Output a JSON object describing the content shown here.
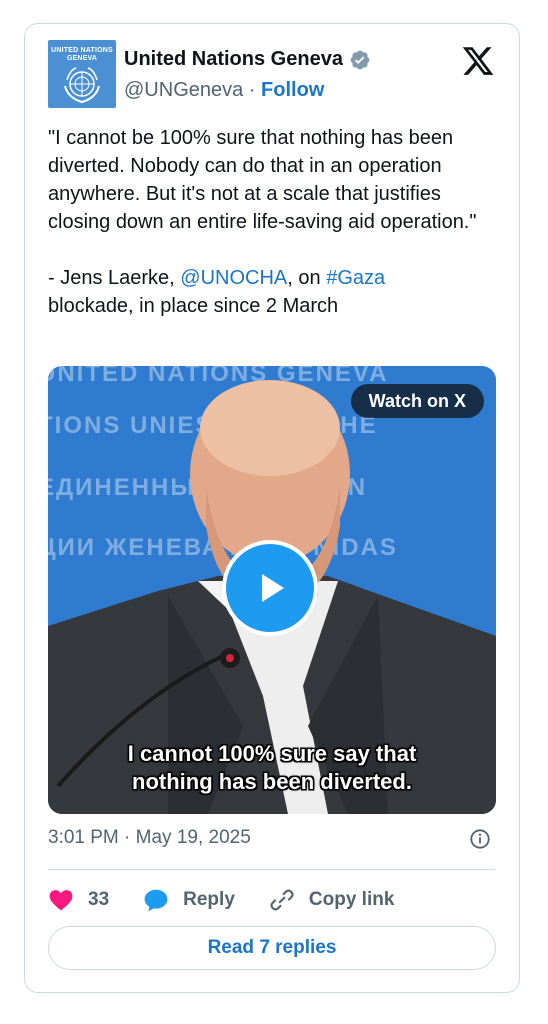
{
  "account": {
    "name": "United Nations Geneva",
    "handle": "@UNGeneva",
    "separator": "·",
    "follow_label": "Follow",
    "avatar_text_line1": "UNITED NATIONS",
    "avatar_text_line2": "GENEVA",
    "verified_color": "#829aab"
  },
  "tweet": {
    "quote": "\"I cannot be 100% sure that nothing has been diverted. Nobody can do that in an operation anywhere. But it's not at a scale that justifies closing down an entire life-saving aid operation.\"",
    "attribution_prefix": "- Jens Laerke, ",
    "mention": "@UNOCHA",
    "attribution_mid": ", on ",
    "hashtag": "#Gaza",
    "attribution_suffix": "blockade, in place since 2 March"
  },
  "media": {
    "watch_label": "Watch on X",
    "subtitle": "I cannot 100% sure say that\nnothing has been diverted.",
    "background_lines": [
      "UNITED NATIONS GENEVA",
      "TIONS UNIES          ОБЪЕДИНЕ",
      "ЕДИНЕННЫЕ             ЖЕНЕВА   N",
      "ЦИИ ЖЕНЕВА            NES UNIDAS"
    ],
    "accent_color": "#1d9bf0"
  },
  "meta": {
    "timestamp": "3:01 PM · May 19, 2025"
  },
  "actions": {
    "like_count": "33",
    "reply_label": "Reply",
    "copy_label": "Copy link",
    "read_replies_label": "Read 7 replies",
    "like_color": "#f91880",
    "reply_color": "#1d9bf0"
  },
  "icons": [
    "x-logo-icon",
    "verified-badge-icon",
    "heart-icon",
    "reply-bubble-icon",
    "link-icon",
    "info-icon",
    "play-icon",
    "un-emblem-icon"
  ]
}
